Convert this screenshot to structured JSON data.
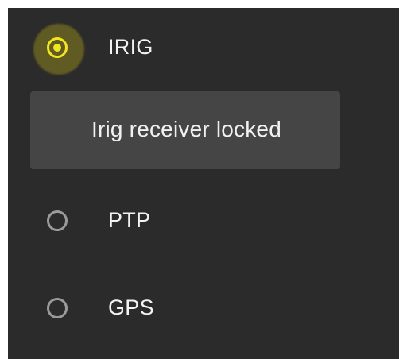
{
  "options": [
    {
      "label": "IRIG",
      "selected": true
    },
    {
      "label": "PTP",
      "selected": false
    },
    {
      "label": "GPS",
      "selected": false
    }
  ],
  "status": {
    "text": "Irig receiver locked"
  },
  "colors": {
    "accent": "#f2e51f",
    "panel_background": "#2b2b2b",
    "status_background": "#454545",
    "unselected_radio": "#9a9a9a"
  }
}
